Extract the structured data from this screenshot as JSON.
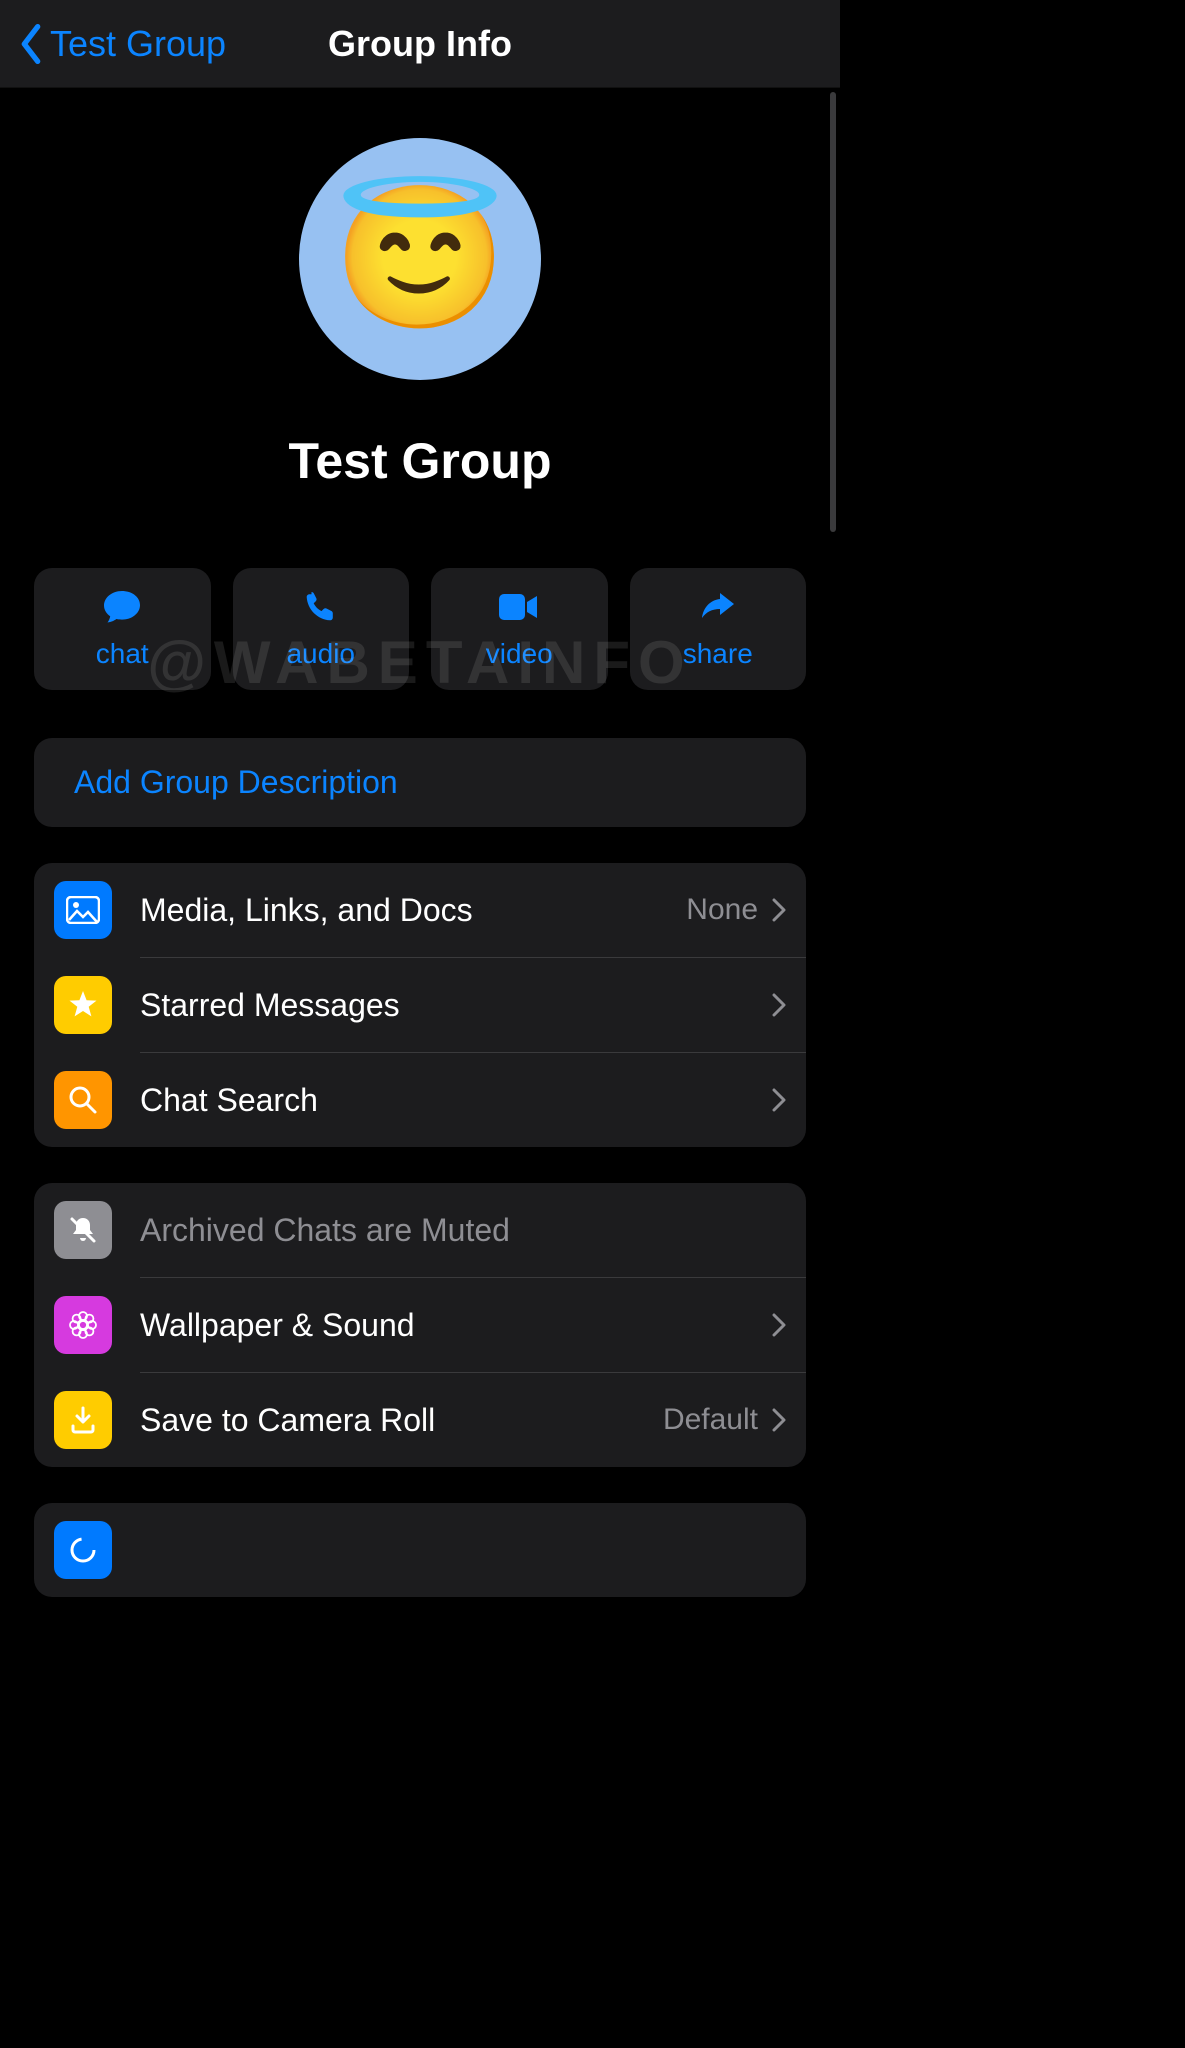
{
  "nav": {
    "back_label": "Test Group",
    "title": "Group Info"
  },
  "group": {
    "name": "Test Group",
    "avatar_emoji": "😇"
  },
  "actions": {
    "chat": "chat",
    "audio": "audio",
    "video": "video",
    "share": "share"
  },
  "watermark": "@WABETAINFO",
  "description": {
    "add_label": "Add Group Description"
  },
  "section1": {
    "media": {
      "label": "Media, Links, and Docs",
      "value": "None"
    },
    "starred": {
      "label": "Starred Messages"
    },
    "search": {
      "label": "Chat Search"
    }
  },
  "section2": {
    "archived": {
      "label": "Archived Chats are Muted"
    },
    "wallpaper": {
      "label": "Wallpaper & Sound"
    },
    "camera": {
      "label": "Save to Camera Roll",
      "value": "Default"
    }
  }
}
